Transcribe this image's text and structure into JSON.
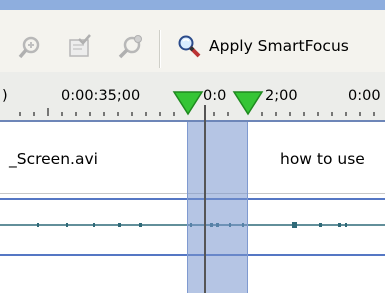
{
  "toolbar": {
    "icons": [
      "zoom-in-icon",
      "document-check-icon",
      "zoom-settings-icon",
      "magnifier-icon"
    ],
    "apply_label": "Apply SmartFocus"
  },
  "ruler": {
    "labels": [
      ")",
      "0:00:35;00",
      "0:0",
      "2;00",
      "0:00"
    ]
  },
  "clips": {
    "left_label": "_Screen.avi",
    "right_label": "how to use"
  },
  "colors": {
    "accent": "#8eaede",
    "selection": "#7896cd",
    "marker_green": "#35c535",
    "track_line": "#5577c4"
  }
}
